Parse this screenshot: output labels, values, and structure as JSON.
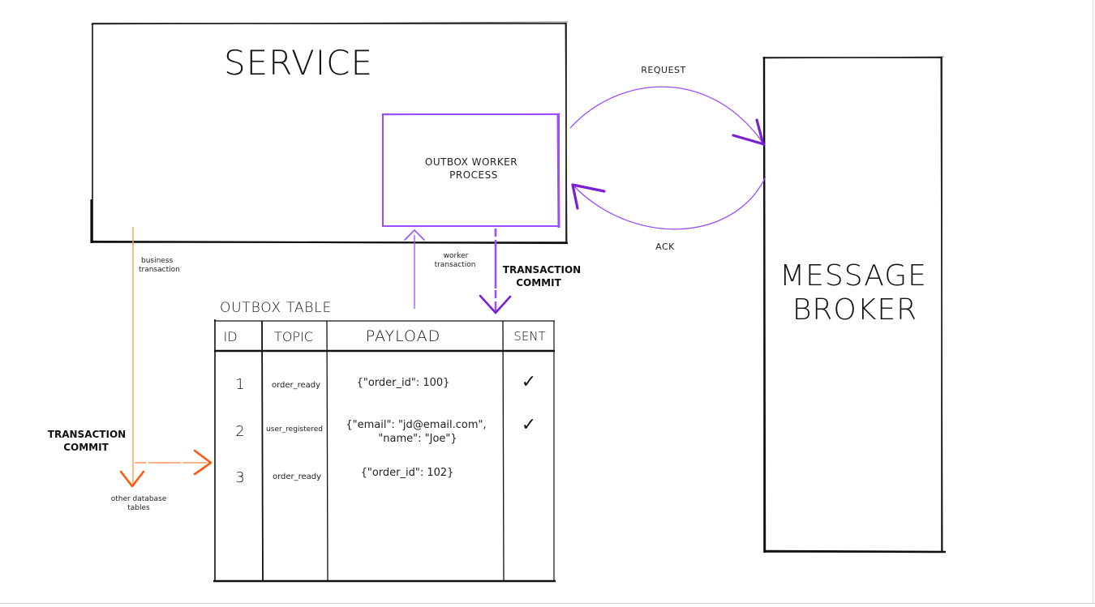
{
  "service": {
    "title": "SERVICE"
  },
  "worker": {
    "line1": "OUTBOX WORKER",
    "line2": "PROCESS"
  },
  "broker": {
    "line1": "MESSAGE",
    "line2": "BROKER"
  },
  "arrows": {
    "request": "REQUEST",
    "ack": "ACK",
    "business_transaction_line1": "business",
    "business_transaction_line2": "transaction",
    "worker_transaction_line1": "worker",
    "worker_transaction_line2": "transaction",
    "tx_commit_right_line1": "TRANSACTION",
    "tx_commit_right_line2": "COMMIT",
    "tx_commit_left_line1": "TRANSACTION",
    "tx_commit_left_line2": "COMMIT",
    "other_tables_line1": "other database",
    "other_tables_line2": "tables"
  },
  "outbox": {
    "title": "OUTBOX TABLE",
    "columns": [
      "ID",
      "TOPIC",
      "PAYLOAD",
      "SENT"
    ],
    "rows": [
      {
        "id": "1",
        "topic": "order_ready",
        "payload_line1": "{\"order_id\": 100}",
        "payload_line2": "",
        "sent": "✓"
      },
      {
        "id": "2",
        "topic": "user_registered",
        "payload_line1": "{\"email\": \"jd@email.com\",",
        "payload_line2": "\"name\": \"Joe\"}",
        "sent": "✓"
      },
      {
        "id": "3",
        "topic": "order_ready",
        "payload_line1": "{\"order_id\": 102}",
        "payload_line2": "",
        "sent": ""
      }
    ]
  },
  "colors": {
    "ink": "#111111",
    "worker_purple": "#9b4dff",
    "arrow_purple": "#7a1fd6",
    "arrow_orange": "#ff5a0a",
    "line_orange": "#ff9a5c"
  }
}
